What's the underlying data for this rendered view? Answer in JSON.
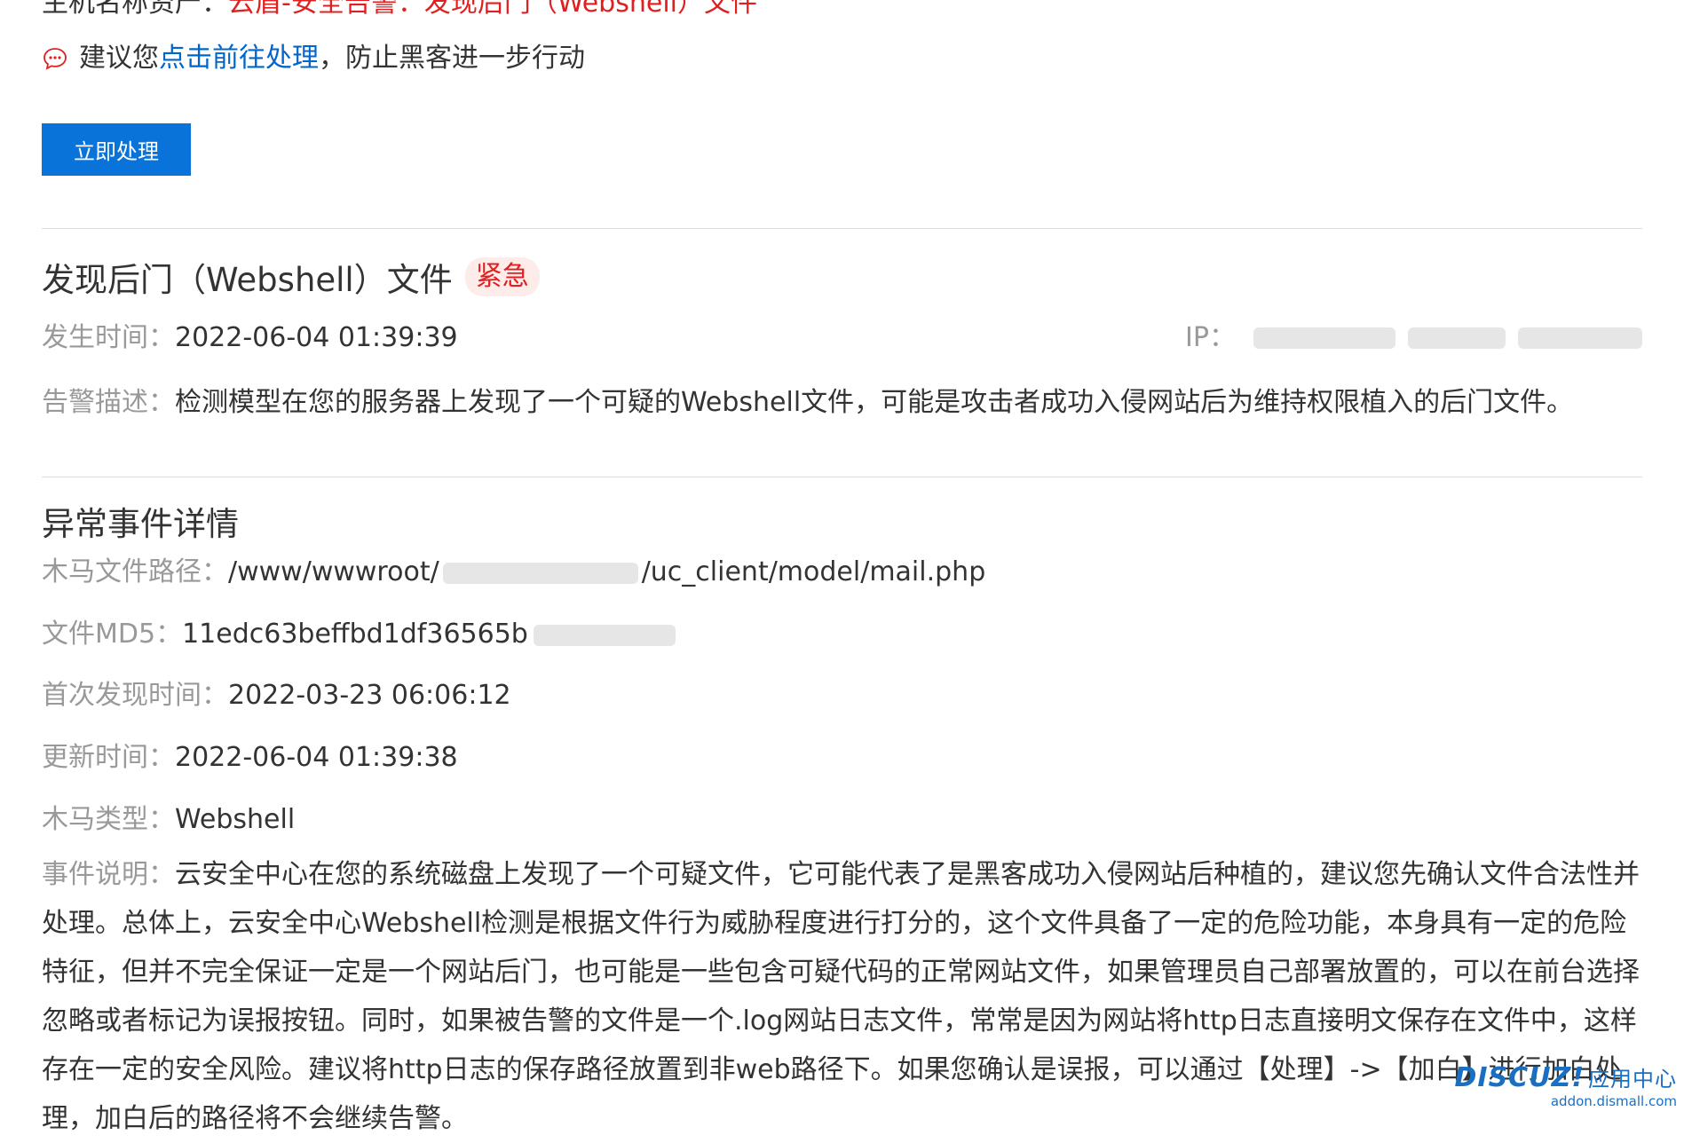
{
  "top_cut": {
    "prefix": "主机名称资产：",
    "highlight": "云盾-安全告警：发现后门（Webshell）文件"
  },
  "suggestion": {
    "prefix": "建议您",
    "link": "点击前往处理",
    "suffix": "，防止黑客进一步行动"
  },
  "action_button": "立即处理",
  "alert": {
    "title": "发现后门（Webshell）文件",
    "badge": "紧急",
    "time_label": "发生时间：",
    "time_value": "2022-06-04 01:39:39",
    "ip_label": "IP：",
    "desc_label": "告警描述：",
    "desc_value": "检测模型在您的服务器上发现了一个可疑的Webshell文件，可能是攻击者成功入侵网站后为维持权限植入的后门文件。"
  },
  "details": {
    "title": "异常事件详情",
    "path_label": "木马文件路径：",
    "path_prefix": "/www/wwwroot/",
    "path_suffix": "/uc_client/model/mail.php",
    "md5_label": "文件MD5：",
    "md5_value": "11edc63beffbd1df36565b",
    "first_label": "首次发现时间：",
    "first_value": "2022-03-23 06:06:12",
    "update_label": "更新时间：",
    "update_value": "2022-06-04 01:39:38",
    "type_label": "木马类型：",
    "type_value": "Webshell",
    "explain_label": "事件说明：",
    "explain_value": "云安全中心在您的系统磁盘上发现了一个可疑文件，它可能代表了是黑客成功入侵网站后种植的，建议您先确认文件合法性并处理。总体上，云安全中心Webshell检测是根据文件行为威胁程度进行打分的，这个文件具备了一定的危险功能，本身具有一定的危险特征，但并不完全保证一定是一个网站后门，也可能是一些包含可疑代码的正常网站文件，如果管理员自己部署放置的，可以在前台选择忽略或者标记为误报按钮。同时，如果被告警的文件是一个.log网站日志文件，常常是因为网站将http日志直接明文保存在文件中，这样存在一定的安全风险。建议将http日志的保存路径放置到非web路径下。如果您确认是误报，可以通过【处理】->【加白】进行加白处理，加白后的路径将不会继续告警。"
  },
  "watermark": {
    "brand": "DISCUZ!",
    "cn": "应用中心",
    "domain": "addon.dismall.com"
  },
  "colors": {
    "primary": "#0a73d9",
    "danger": "#e02020",
    "link": "#0066cc",
    "label": "#999999"
  }
}
